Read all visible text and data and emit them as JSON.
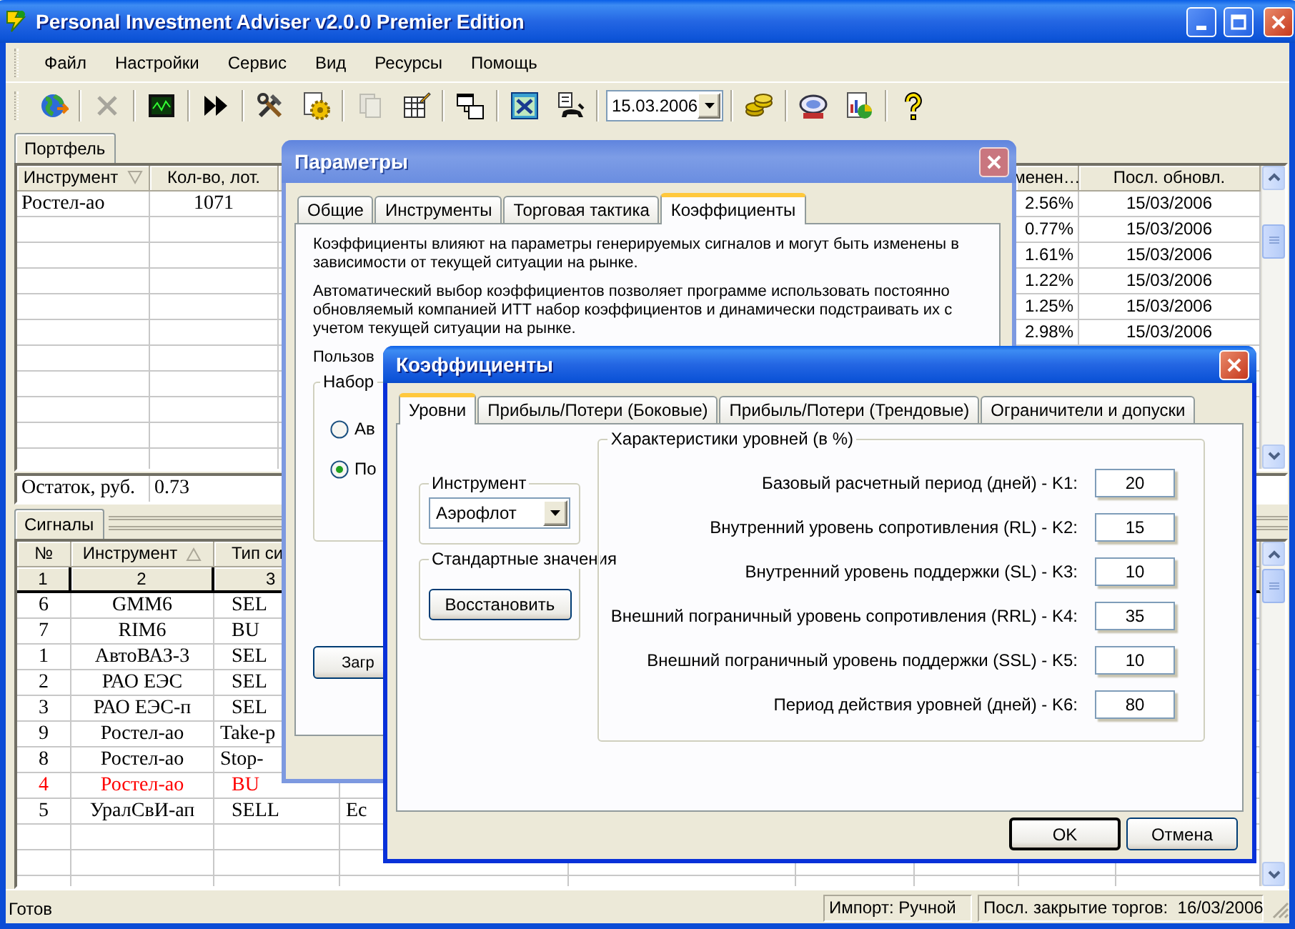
{
  "window": {
    "title": "Personal Investment Adviser v2.0.0 Premier Edition"
  },
  "menu": [
    "Файл",
    "Настройки",
    "Сервис",
    "Вид",
    "Ресурсы",
    "Помощь"
  ],
  "toolbar": [
    {
      "kind": "button",
      "disabled": false
    },
    {
      "kind": "separator"
    },
    {
      "kind": "button",
      "disabled": true
    },
    {
      "kind": "separator"
    },
    {
      "kind": "button",
      "disabled": false
    },
    {
      "kind": "separator"
    },
    {
      "kind": "button",
      "disabled": false
    },
    {
      "kind": "separator"
    },
    {
      "kind": "button",
      "disabled": false
    },
    {
      "kind": "button",
      "disabled": false
    },
    {
      "kind": "separator"
    },
    {
      "kind": "button",
      "disabled": true
    },
    {
      "kind": "button",
      "disabled": false
    },
    {
      "kind": "separator"
    },
    {
      "kind": "button",
      "disabled": false
    },
    {
      "kind": "separator"
    },
    {
      "kind": "button",
      "disabled": false
    },
    {
      "kind": "button",
      "disabled": false
    },
    {
      "kind": "separator"
    },
    {
      "kind": "date",
      "value": "15.03.2006"
    },
    {
      "kind": "separator"
    },
    {
      "kind": "button",
      "disabled": false
    },
    {
      "kind": "separator"
    },
    {
      "kind": "button",
      "disabled": false
    },
    {
      "kind": "button",
      "disabled": false
    },
    {
      "kind": "separator"
    },
    {
      "kind": "button",
      "disabled": false
    }
  ],
  "portfolio": {
    "tab": "Портфель",
    "columns": [
      {
        "label": "Инструмент",
        "sort_descending": true
      },
      {
        "label": "Кол-во, лот."
      },
      {
        "label": "менен…"
      },
      {
        "label": "Посл. обновл."
      }
    ],
    "rows": [
      {
        "instrument": "Ростел-ао",
        "lots": "1071",
        "column_3": "2.56%",
        "updated": "15/03/2006"
      },
      {
        "column_3": "0.77%",
        "updated": "15/03/2006"
      },
      {
        "column_3": "1.61%",
        "updated": "15/03/2006"
      },
      {
        "column_3": "1.22%",
        "updated": "15/03/2006"
      },
      {
        "column_3": "1.25%",
        "updated": "15/03/2006"
      },
      {
        "column_3": "2.98%",
        "updated": "15/03/2006"
      }
    ],
    "balance": {
      "label": "Остаток, руб.",
      "value": "0.73"
    }
  },
  "signals": {
    "tab": "Сигналы",
    "columns": [
      {
        "label": "№"
      },
      {
        "label": "Инструмент",
        "sort_descending": false
      },
      {
        "label": "Тип си"
      }
    ],
    "index_row": [
      "1",
      "2",
      "3"
    ],
    "rows": [
      {
        "number": "6",
        "instrument": "GMM6",
        "type": "SEL",
        "highlighted": false
      },
      {
        "number": "7",
        "instrument": "RIM6",
        "type": "BU",
        "highlighted": false
      },
      {
        "number": "1",
        "instrument": "АвтоВАЗ-3",
        "type": "SEL",
        "highlighted": false
      },
      {
        "number": "2",
        "instrument": "РАО ЕЭС",
        "type": "SEL",
        "highlighted": false
      },
      {
        "number": "3",
        "instrument": "РАО ЕЭС-п",
        "type": "SEL",
        "highlighted": false
      },
      {
        "number": "9",
        "instrument": "Ростел-ао",
        "type": "Take-p",
        "highlighted": false
      },
      {
        "number": "8",
        "instrument": "Ростел-ао",
        "type": "Stop-",
        "highlighted": false
      },
      {
        "number": "4",
        "instrument": "Ростел-ао",
        "type": "BU",
        "highlighted": true
      },
      {
        "number": "5",
        "instrument": "УралСвИ-ап",
        "type": "SELL",
        "column_4": "Ec",
        "highlighted": false
      }
    ]
  },
  "status_bar": {
    "message": "Готов",
    "import": "Импорт: Ручной",
    "last_close": "Посл. закрытие торгов:  16/03/2006"
  },
  "params_dialog": {
    "title": "Параметры",
    "tabs": [
      {
        "label": "Общие",
        "selected": false
      },
      {
        "label": "Инструменты",
        "selected": false
      },
      {
        "label": "Торговая тактика",
        "selected": false
      },
      {
        "label": "Коэффициенты",
        "selected": true
      }
    ],
    "paragraphs": [
      "Коэффициенты влияют на параметры генерируемых сигналов и могут быть изменены в зависимости от текущей ситуации на рынке.",
      "Автоматический выбор коэффициентов позволяет программе использовать постоянно обновляемый компанией ИТТ набор коэффициентов и динамически подстраивать их с учетом текущей ситуации на рынке.",
      "Пользов"
    ],
    "group": {
      "title": "Набор",
      "options": [
        {
          "label": "Ав",
          "selected": false
        },
        {
          "label": "По",
          "selected": true
        }
      ]
    },
    "button": "Загр"
  },
  "coefficients_dialog": {
    "title": "Коэффициенты",
    "tabs": [
      {
        "label": "Уровни",
        "selected": true
      },
      {
        "label": "Прибыль/Потери (Боковые)",
        "selected": false
      },
      {
        "label": "Прибыль/Потери (Трендовые)",
        "selected": false
      },
      {
        "label": "Ограничители и допуски",
        "selected": false
      }
    ],
    "instrument_group": {
      "title": "Инструмент",
      "value": "Аэрофлот"
    },
    "defaults_group": {
      "title": "Стандартные значения",
      "button": "Восстановить"
    },
    "levels_group": {
      "title": "Характеристики уровней (в %)",
      "rows": [
        {
          "label": "Базовый расчетный период (дней) - K1:",
          "value": "20"
        },
        {
          "label": "Внутренний уровень сопротивления (RL) - K2:",
          "value": "15"
        },
        {
          "label": "Внутренний уровень поддержки (SL) - K3:",
          "value": "10"
        },
        {
          "label": "Внешний пограничный уровень сопротивления (RRL) - K4:",
          "value": "35"
        },
        {
          "label": "Внешний пограничный уровень поддержки (SSL) - K5:",
          "value": "10"
        },
        {
          "label": "Период действия уровней (дней) - K6:",
          "value": "80"
        }
      ]
    },
    "buttons": [
      "OK",
      "Отмена"
    ]
  }
}
